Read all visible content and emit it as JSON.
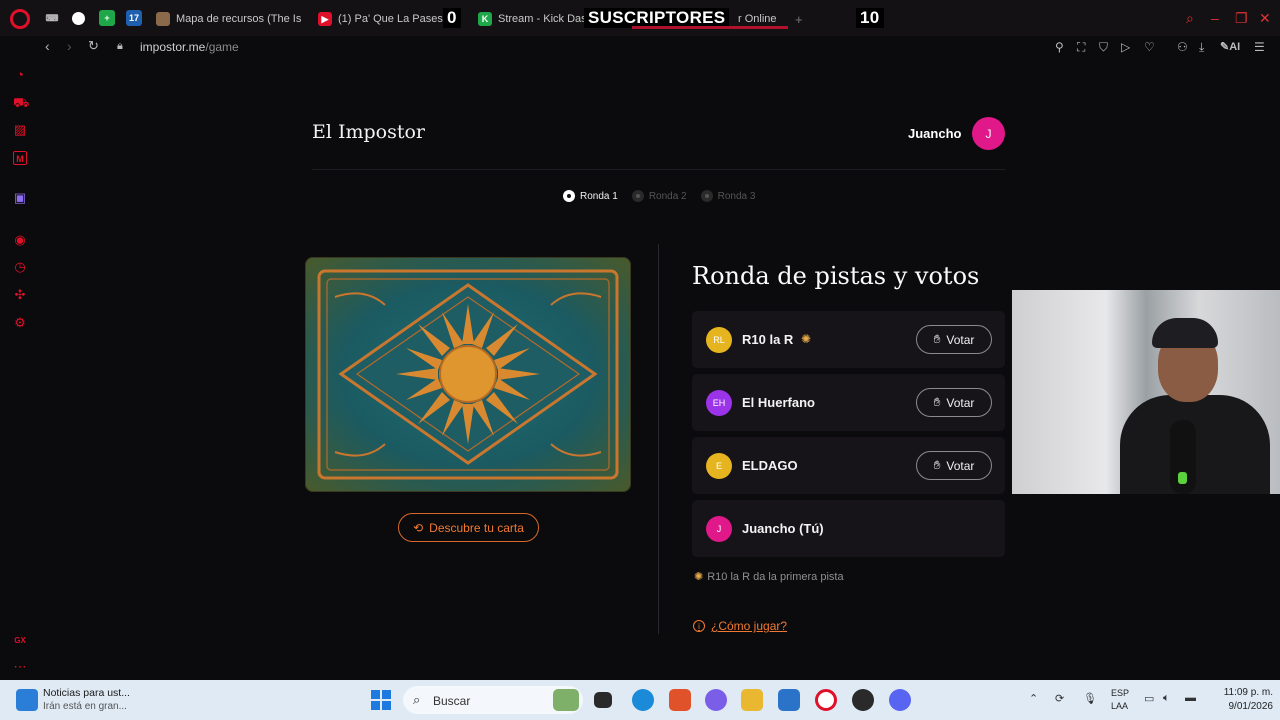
{
  "browser": {
    "tabs": [
      {
        "label": "Mapa de recursos (The Isl",
        "color": "#8a6a4a"
      },
      {
        "label": "(1) Pa' Que La Pases Bie",
        "color": "#e0102b"
      },
      {
        "label": "Stream - Kick Dashb",
        "color": "#1fa84a"
      },
      {
        "label": "r Online",
        "color": "#b0122e"
      }
    ],
    "pinned_tab_badge": "17",
    "new_tab": "+",
    "url_host": "impostor.me",
    "url_path": "/game",
    "ai_label": "AI"
  },
  "stream_overlay": {
    "count_left": "0",
    "label": "SUSCRIPTORES",
    "count_right": "10"
  },
  "page": {
    "title": "El Impostor",
    "user": {
      "name": "Juancho",
      "initial": "J"
    },
    "rounds": [
      {
        "label": "Ronda 1",
        "active": true
      },
      {
        "label": "Ronda 2",
        "active": false
      },
      {
        "label": "Ronda 3",
        "active": false
      }
    ],
    "discover_button": "Descubre tu carta",
    "phase_title": "Ronda de pistas y votos",
    "players": [
      {
        "initials": "RL",
        "name": "R10 la R",
        "color": "#e6b41e",
        "has_sun": true,
        "vote": "Votar"
      },
      {
        "initials": "EH",
        "name": "El Huerfano",
        "color": "#9b33e8",
        "has_sun": false,
        "vote": "Votar"
      },
      {
        "initials": "E",
        "name": "ELDAGO",
        "color": "#e6b41e",
        "has_sun": false,
        "vote": "Votar"
      },
      {
        "initials": "J",
        "name": "Juancho (Tú)",
        "color": "#e0188a",
        "has_sun": false,
        "vote": ""
      }
    ],
    "clue_text": "R10 la R da la primera pista",
    "howto_link": "¿Cómo jugar?",
    "howto_icon": "i"
  },
  "taskbar": {
    "news_title": "Noticias para ust...",
    "news_sub": "Irán está en gran...",
    "search_placeholder": "Buscar",
    "lang_1": "ESP",
    "lang_2": "LAA",
    "time": "11:09 p. m.",
    "date": "9/01/2026"
  },
  "colors": {
    "accent_orange": "#f07a33",
    "opera_red": "#e0102b",
    "avatar_pink": "#e0188a"
  }
}
